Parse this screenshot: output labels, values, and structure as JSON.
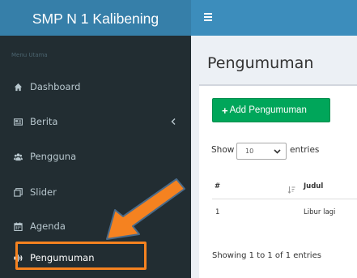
{
  "app": {
    "title": "SMP N 1 Kalibening"
  },
  "sidebar": {
    "header": "Menu Utama",
    "items": [
      {
        "label": "Dashboard",
        "icon": "home-icon"
      },
      {
        "label": "Berita",
        "icon": "newspaper-icon",
        "has_submenu": true
      },
      {
        "label": "Pengguna",
        "icon": "users-icon"
      },
      {
        "label": "Slider",
        "icon": "clone-icon"
      },
      {
        "label": "Agenda",
        "icon": "calendar-icon"
      },
      {
        "label": "Pengumuman",
        "icon": "volume-icon",
        "highlighted": true
      }
    ]
  },
  "page": {
    "title": "Pengumuman"
  },
  "toolbar": {
    "add_label": "Add Pengumuman"
  },
  "table": {
    "show_label": "Show",
    "entries_value": "10",
    "entries_label": "entries",
    "columns": [
      "#",
      "Judul"
    ],
    "rows": [
      {
        "no": "1",
        "judul": "Libur lagi"
      }
    ],
    "info": "Showing 1 to 1 of 1 entries"
  },
  "colors": {
    "topbar": "#3c8dbc",
    "brand": "#367fa9",
    "sidebar": "#222d32",
    "button": "#00a65a",
    "annotation": "#f58220"
  }
}
